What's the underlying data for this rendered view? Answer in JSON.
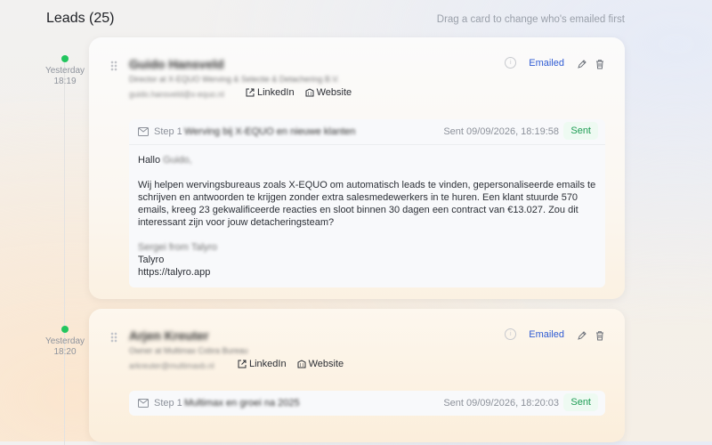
{
  "header": {
    "title": "Leads (25)",
    "hint": "Drag a card to change who's emailed first"
  },
  "leads": [
    {
      "time_day": "Yesterday",
      "time": "18:19",
      "name": "Guido Hansveld",
      "role": "Director at X-EQUO Werving & Selectie & Detachering B.V.",
      "email": "guido.hansveld@x-equo.nl",
      "linkedin": "LinkedIn",
      "website": "Website",
      "status": "Emailed",
      "step": {
        "label": "Step 1",
        "subject": "Werving bij X-EQUO en nieuwe klanten",
        "sent_at": "Sent 09/09/2026, 18:19:58",
        "status": "Sent",
        "greeting": "Hallo",
        "greeting_name": "Guido,",
        "body": "Wij helpen wervingsbureaus zoals X-EQUO om automatisch leads te vinden, gepersonaliseerde emails te schrijven en antwoorden te krijgen zonder extra salesmedewerkers in te huren. Een klant stuurde 570 emails, kreeg 23 gekwalificeerde reacties en sloot binnen 30 dagen een contract van €13.027. Zou dit interessant zijn voor jouw detacheringsteam?",
        "signoff": "Sergei from Talyro",
        "sig1": "Talyro",
        "sig2": "https://talyro.app"
      }
    },
    {
      "time_day": "Yesterday",
      "time": "18:20",
      "name": "Arjen Kreuter",
      "role": "Owner at Multimax Cobra Bureau",
      "email": "arkreuter@multimaxb.nl",
      "linkedin": "LinkedIn",
      "website": "Website",
      "status": "Emailed",
      "step": {
        "label": "Step 1",
        "subject": "Multimax en groei na 2025",
        "sent_at": "Sent 09/09/2026, 18:20:03",
        "status": "Sent"
      }
    }
  ]
}
